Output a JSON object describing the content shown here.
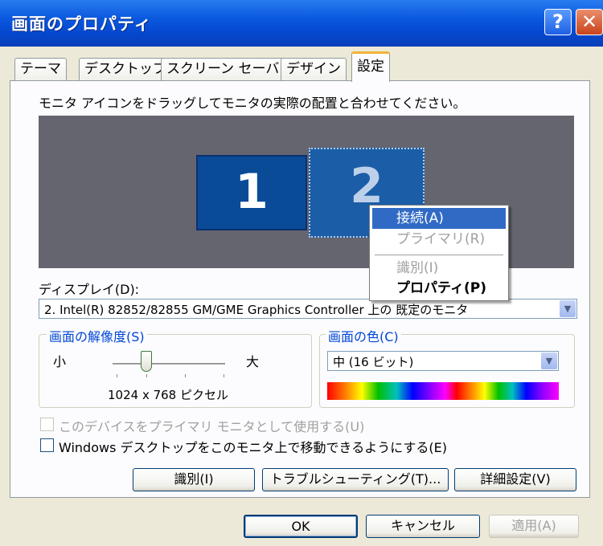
{
  "window": {
    "title": "画面のプロパティ",
    "help_glyph": "?",
    "close_glyph": "✕"
  },
  "tabs": [
    {
      "label": "テーマ",
      "active": false
    },
    {
      "label": "デスクトップ",
      "active": false
    },
    {
      "label": "スクリーン セーバー",
      "active": false
    },
    {
      "label": "デザイン",
      "active": false
    },
    {
      "label": "設定",
      "active": true
    }
  ],
  "instruction": "モニタ アイコンをドラッグしてモニタの実際の配置と合わせてください。",
  "monitors": [
    {
      "label": "1"
    },
    {
      "label": "2"
    }
  ],
  "context_menu": {
    "items": [
      {
        "label": "接続(A)",
        "state": "highlighted"
      },
      {
        "label": "プライマリ(R)",
        "state": "disabled"
      },
      {
        "label": "識別(I)",
        "state": "disabled"
      },
      {
        "label": "プロパティ(P)",
        "state": "default-bold"
      }
    ]
  },
  "display": {
    "label": "ディスプレイ(D):",
    "value": "2. Intel(R) 82852/82855 GM/GME Graphics Controller 上の 既定のモニタ"
  },
  "resolution": {
    "group_label": "画面の解像度(S)",
    "min_label": "小",
    "max_label": "大",
    "value_text": "1024 x 768 ピクセル"
  },
  "color": {
    "group_label": "画面の色(C)",
    "value": "中 (16 ビット)"
  },
  "checkboxes": [
    {
      "label": "このデバイスをプライマリ モニタとして使用する(U)",
      "checked": false,
      "disabled": true
    },
    {
      "label": "Windows デスクトップをこのモニタ上で移動できるようにする(E)",
      "checked": false,
      "disabled": false
    }
  ],
  "buttons": {
    "identify": "識別(I)",
    "troubleshoot": "トラブルシューティング(T)...",
    "advanced": "詳細設定(V)",
    "ok": "OK",
    "cancel": "キャンセル",
    "apply": "適用(A)"
  },
  "colors": {
    "titlebar": "#0a58de",
    "selection": "#316ac5",
    "group_title": "#0046d5",
    "monitor_area": "#65656f"
  }
}
